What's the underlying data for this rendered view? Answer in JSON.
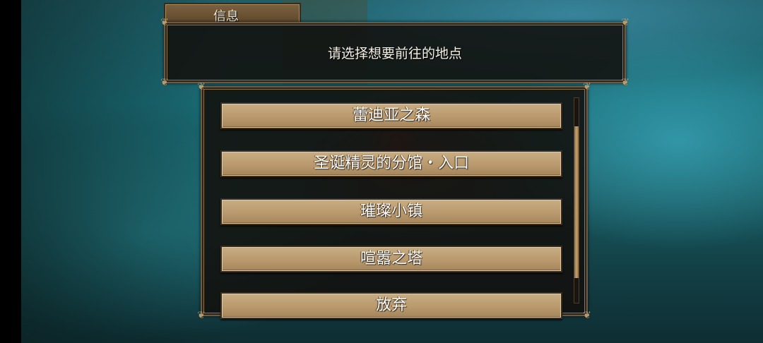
{
  "dialog": {
    "title": "信息",
    "message": "请选择想要前往的地点",
    "options": [
      "蕾迪亚之森",
      "圣诞精灵的分馆・入口",
      "璀璨小镇",
      "喧嚣之塔",
      "放弃"
    ]
  },
  "colors": {
    "button_face": "#c8ad83",
    "panel_border": "#6e5a40",
    "panel_bg": "#12100c",
    "water": "#1b6e78"
  },
  "icons": {
    "corner_ornament": "ornate-corner-icon"
  }
}
